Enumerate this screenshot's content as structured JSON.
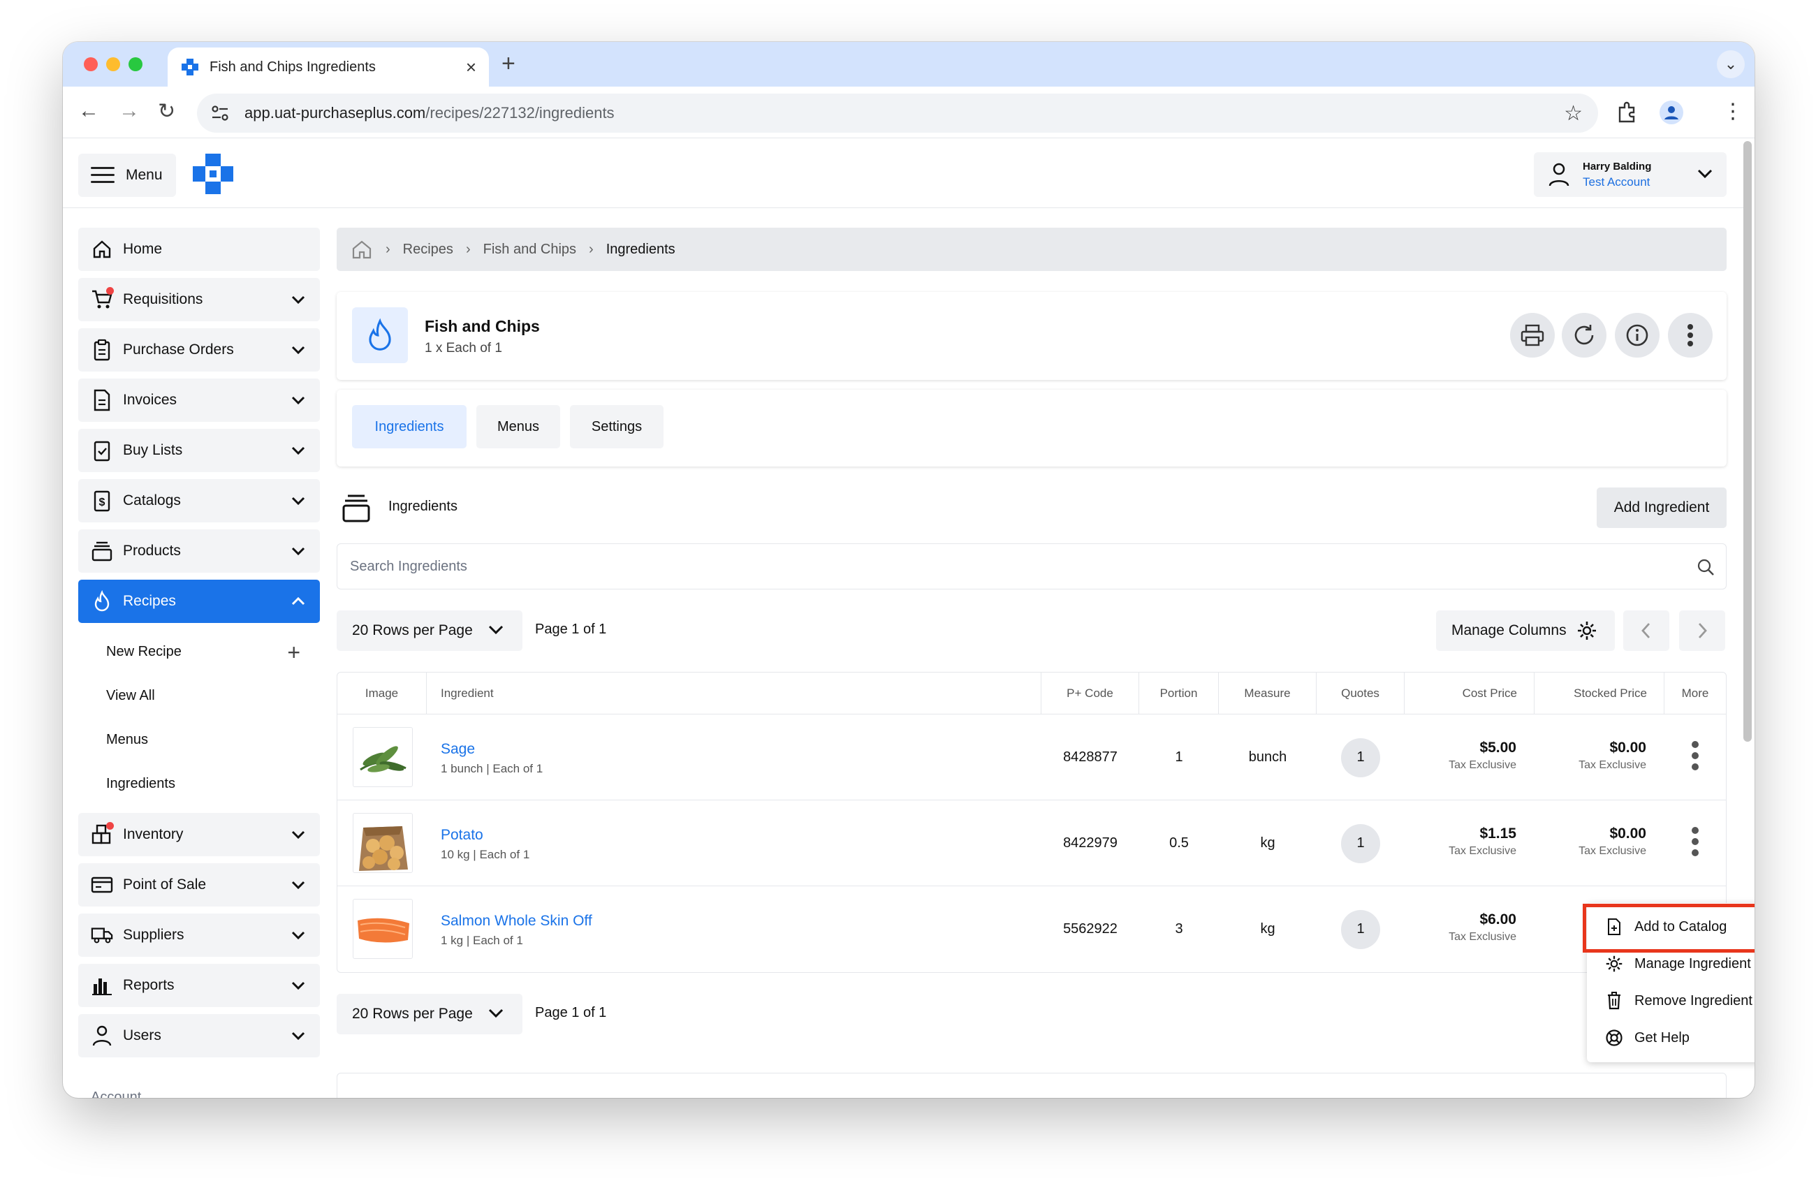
{
  "browser": {
    "tab_title": "Fish and Chips Ingredients",
    "url_domain": "app.uat-purchaseplus.com",
    "url_path": "/recipes/227132/ingredients"
  },
  "header": {
    "menu_label": "Menu",
    "user_name": "Harry Balding",
    "user_account": "Test Account"
  },
  "sidebar": {
    "items": [
      {
        "label": "Home",
        "icon": "home-icon"
      },
      {
        "label": "Requisitions",
        "icon": "cart-icon"
      },
      {
        "label": "Purchase Orders",
        "icon": "clipboard-icon"
      },
      {
        "label": "Invoices",
        "icon": "document-icon"
      },
      {
        "label": "Buy Lists",
        "icon": "checklist-icon"
      },
      {
        "label": "Catalogs",
        "icon": "catalog-icon"
      },
      {
        "label": "Products",
        "icon": "products-icon"
      },
      {
        "label": "Recipes",
        "icon": "flame-icon"
      }
    ],
    "recipe_sub": [
      "New Recipe",
      "View All",
      "Menus",
      "Ingredients"
    ],
    "items_after": [
      {
        "label": "Inventory",
        "icon": "inventory-icon"
      },
      {
        "label": "Point of Sale",
        "icon": "pos-icon"
      },
      {
        "label": "Suppliers",
        "icon": "truck-icon"
      },
      {
        "label": "Reports",
        "icon": "chart-icon"
      },
      {
        "label": "Users",
        "icon": "user-icon"
      }
    ],
    "account_label": "Account"
  },
  "breadcrumb": [
    "Recipes",
    "Fish and Chips",
    "Ingredients"
  ],
  "recipe": {
    "title": "Fish and Chips",
    "subtitle": "1 x Each of 1"
  },
  "tabs": [
    "Ingredients",
    "Menus",
    "Settings"
  ],
  "section": {
    "title": "Ingredients",
    "add_button": "Add Ingredient",
    "search_placeholder": "Search Ingredients"
  },
  "pager": {
    "rows_label": "20 Rows per Page",
    "page_label": "Page 1 of 1",
    "manage_columns": "Manage Columns"
  },
  "table": {
    "headers": [
      "Image",
      "Ingredient",
      "P+ Code",
      "Portion",
      "Measure",
      "Quotes",
      "Cost Price",
      "Stocked Price",
      "More"
    ],
    "rows": [
      {
        "name": "Sage",
        "sub": "1 bunch | Each of 1",
        "code": "8428877",
        "portion": "1",
        "measure": "bunch",
        "quotes": "1",
        "cost": "$5.00",
        "cost_tax": "Tax Exclusive",
        "stocked": "$0.00",
        "stocked_tax": "Tax Exclusive"
      },
      {
        "name": "Potato",
        "sub": "10 kg | Each of 1",
        "code": "8422979",
        "portion": "0.5",
        "measure": "kg",
        "quotes": "1",
        "cost": "$1.15",
        "cost_tax": "Tax Exclusive",
        "stocked": "$0.00",
        "stocked_tax": "Tax Exclusive"
      },
      {
        "name": "Salmon Whole Skin Off",
        "sub": "1 kg | Each of 1",
        "code": "5562922",
        "portion": "3",
        "measure": "kg",
        "quotes": "1",
        "cost": "$6.00",
        "cost_tax": "Tax Exclusive",
        "stocked": "",
        "stocked_tax": ""
      }
    ]
  },
  "context_menu": [
    "Add to Catalog",
    "Manage Ingredient",
    "Remove Ingredient",
    "Get Help"
  ],
  "colors": {
    "accent": "#1a73e8",
    "highlight": "#e8361c"
  }
}
